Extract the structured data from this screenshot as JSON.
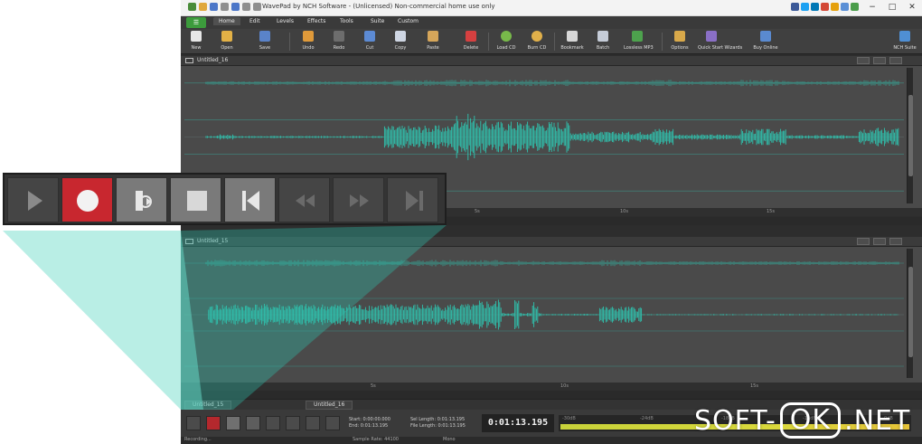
{
  "window": {
    "title": "WavePad by NCH Software - (Unlicensed) Non-commercial home use only",
    "min_glyph": "−",
    "max_glyph": "□",
    "close_glyph": "✕"
  },
  "menu": {
    "app_button": "☰",
    "tabs": [
      "Home",
      "Edit",
      "Levels",
      "Effects",
      "Tools",
      "Suite",
      "Custom"
    ]
  },
  "toolbar": {
    "items": [
      "New",
      "Open",
      "Save",
      "Undo",
      "Redo",
      "Cut",
      "Copy",
      "Paste",
      "Delete",
      "Load CD",
      "Burn CD",
      "Bookmark",
      "Batch",
      "Lossless MP3",
      "Options",
      "Quick Start Wizards",
      "Buy Online",
      "NCH Suite"
    ]
  },
  "tracks": [
    {
      "name": "Untitled_16"
    },
    {
      "name": "Untitled_15"
    }
  ],
  "track_tabs": [
    "Untitled_15",
    "Untitled_16"
  ],
  "timeline_ticks": [
    "5s",
    "10s",
    "15s"
  ],
  "db_labels": [
    "0dB",
    "-12dB",
    "-18dB",
    "-24dB",
    "-30dB"
  ],
  "transport": {
    "start": "Start:",
    "start_value": "0:00:00.000",
    "end": "End:",
    "end_value": "0:01:13.195",
    "sel_length": "Sel Length:",
    "sel_length_value": "0:01:13.195",
    "file_length": "File Length:",
    "file_length_value": "0:01:13.195",
    "time_display": "0:01:13.195"
  },
  "status": {
    "left": "Recording...",
    "sample_rate": "Sample Rate: 44100",
    "channels": "Mono"
  },
  "watermark": {
    "left": "SOFT-",
    "box": "OK",
    "right": ".NET"
  },
  "colors": {
    "waveform": "#2ec4b0",
    "record": "#c8272f",
    "beam": "#7fe0d0",
    "meter": "#d9d93c"
  }
}
